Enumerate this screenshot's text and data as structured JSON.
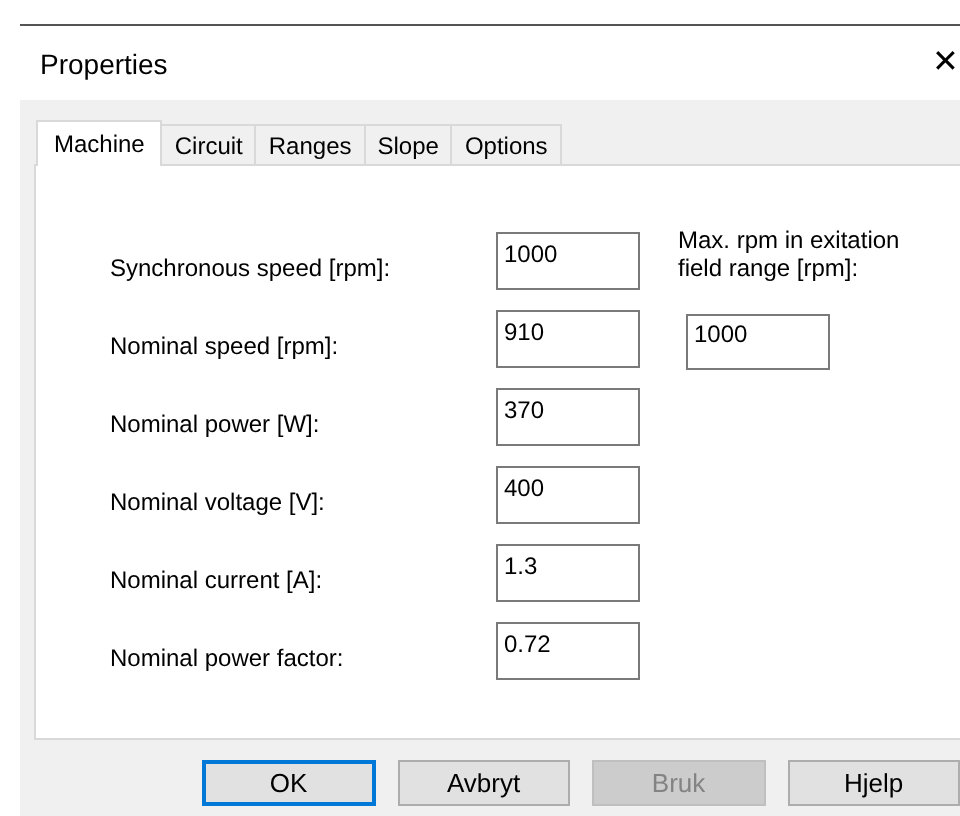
{
  "window": {
    "title": "Properties",
    "close": "✕"
  },
  "tabs": [
    {
      "label": "Machine",
      "selected": true
    },
    {
      "label": "Circuit",
      "selected": false
    },
    {
      "label": "Ranges",
      "selected": false
    },
    {
      "label": "Slope",
      "selected": false
    },
    {
      "label": "Options",
      "selected": false
    }
  ],
  "fields": [
    {
      "label": "Synchronous speed [rpm]:",
      "value": "1000"
    },
    {
      "label": "Nominal speed [rpm]:",
      "value": "910"
    },
    {
      "label": "Nominal power [W]:",
      "value": "370"
    },
    {
      "label": "Nominal voltage [V]:",
      "value": "400"
    },
    {
      "label": "Nominal current [A]:",
      "value": "1.3"
    },
    {
      "label": "Nominal power factor:",
      "value": "0.72"
    }
  ],
  "side_field": {
    "label": "Max. rpm in exitation field range [rpm]:",
    "value": "1000"
  },
  "buttons": [
    {
      "label": "OK",
      "default": true,
      "disabled": false
    },
    {
      "label": "Avbryt",
      "default": false,
      "disabled": false
    },
    {
      "label": "Bruk",
      "default": false,
      "disabled": true
    },
    {
      "label": "Hjelp",
      "default": false,
      "disabled": false
    }
  ]
}
